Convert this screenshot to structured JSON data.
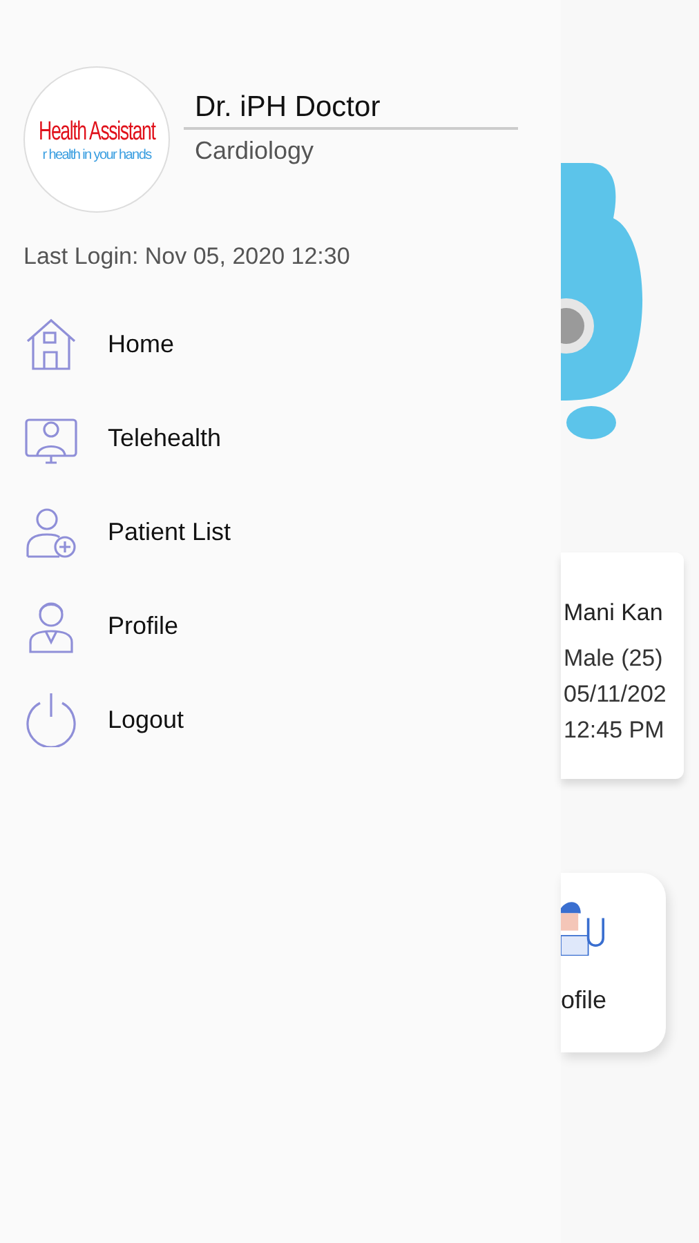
{
  "drawer": {
    "logo": {
      "title": "Health Assistant",
      "tagline": "r health in your hands"
    },
    "doctor_name": "Dr. iPH Doctor",
    "specialty": "Cardiology",
    "last_login": "Last Login: Nov 05, 2020 12:30",
    "menu": [
      {
        "kind": "home",
        "label": "Home"
      },
      {
        "kind": "telehealth",
        "label": "Telehealth"
      },
      {
        "kind": "patients",
        "label": "Patient List"
      },
      {
        "kind": "profile",
        "label": "Profile"
      },
      {
        "kind": "logout",
        "label": "Logout"
      }
    ]
  },
  "background": {
    "appointment_card": {
      "name": "Mani Kan",
      "details": [
        "Male (25)",
        "05/11/202",
        "12:45 PM"
      ]
    },
    "profile_tile": {
      "label": "ofile"
    }
  }
}
